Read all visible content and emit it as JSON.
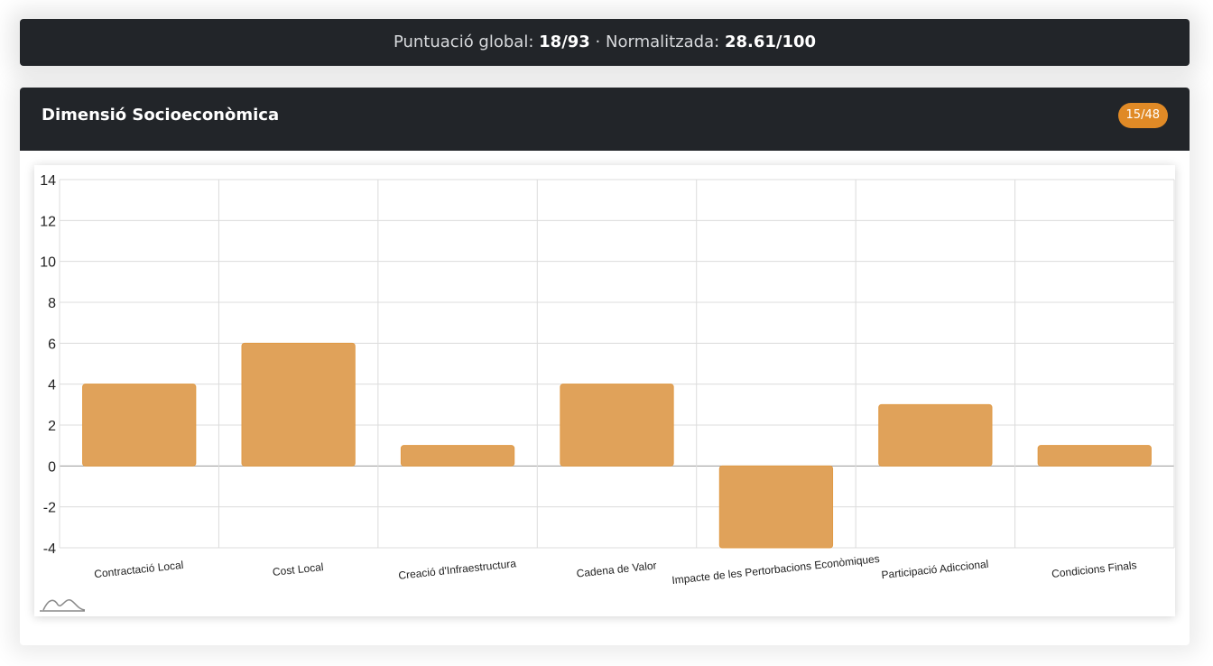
{
  "summary": {
    "global_label": "Puntuació global:",
    "global_value": "18/93",
    "separator": "·",
    "normalized_label": "Normalitzada:",
    "normalized_value": "28.61/100"
  },
  "section": {
    "title": "Dimensió Socioeconòmica",
    "badge": "15/48"
  },
  "colors": {
    "bar": "#e0a25a",
    "bar_border": "#e09a46",
    "badge": "#e08a26",
    "header": "#222529"
  },
  "watermark_icon": "mountain-line-logo-icon",
  "chart_data": {
    "type": "bar",
    "title": "",
    "xlabel": "",
    "ylabel": "",
    "categories": [
      "Contractació Local",
      "Cost Local",
      "Creació d'Infraestructura",
      "Cadena de Valor",
      "Impacte de les Pertorbacions Econòmiques",
      "Participació Adiccional",
      "Condicions Finals"
    ],
    "values": [
      4,
      6,
      1,
      4,
      -4,
      3,
      1
    ],
    "ylim": [
      -4,
      14
    ],
    "yticks": [
      14,
      12,
      10,
      8,
      6,
      4,
      2,
      0,
      -2,
      -4
    ],
    "grid": true,
    "legend": "none"
  }
}
